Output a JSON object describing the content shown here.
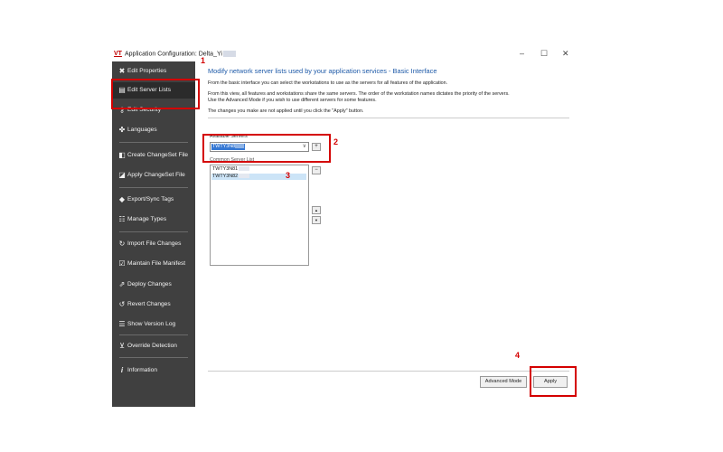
{
  "window": {
    "logo_text": "VT",
    "title": "Application Configuration: Delta_Yi",
    "minimize_glyph": "–",
    "maximize_glyph": "☐",
    "close_glyph": "✕"
  },
  "sidebar": {
    "items": [
      {
        "label": "Edit Properties",
        "icon": "wrench-icon",
        "glyph": "✖"
      },
      {
        "label": "Edit Server Lists",
        "icon": "server-icon",
        "glyph": "▤"
      },
      {
        "label": "Edit Security",
        "icon": "key-icon",
        "glyph": "⚷"
      },
      {
        "label": "Languages",
        "icon": "languages-icon",
        "glyph": "✤"
      },
      {
        "label": "Create ChangeSet File",
        "icon": "create-file-icon",
        "glyph": "◧"
      },
      {
        "label": "Apply ChangeSet File",
        "icon": "apply-file-icon",
        "glyph": "◪"
      },
      {
        "label": "Export/Sync Tags",
        "icon": "tag-icon",
        "glyph": "◆"
      },
      {
        "label": "Manage Types",
        "icon": "types-icon",
        "glyph": "☷"
      },
      {
        "label": "Import File Changes",
        "icon": "sync-icon",
        "glyph": "↻"
      },
      {
        "label": "Maintain File Manifest",
        "icon": "checkbox-icon",
        "glyph": "☑"
      },
      {
        "label": "Deploy Changes",
        "icon": "deploy-icon",
        "glyph": "⇗"
      },
      {
        "label": "Revert Changes",
        "icon": "revert-icon",
        "glyph": "↺"
      },
      {
        "label": "Show Version Log",
        "icon": "list-icon",
        "glyph": "☰"
      },
      {
        "label": "Override Detection",
        "icon": "override-icon",
        "glyph": "⊻"
      },
      {
        "label": "Information",
        "icon": "info-icon",
        "glyph": "i"
      }
    ]
  },
  "main": {
    "heading": "Modify network server lists used by your application services - Basic Interface",
    "line1": "From the basic interface you can select the workstations to use as the servers for all features of the application.",
    "line2a": "From this view, all features and workstations share the same servers. The order of the workstation names dictates the priority of the servers.",
    "line2b": "Use the Advanced Mode if you wish to use different servers for some features.",
    "line3": "The changes you make are not applied until you click the \"Apply\" button.",
    "available_label": "Available Servers",
    "available_value": "TWTY3N8",
    "common_label": "Common Server List",
    "servers": [
      "TWTY3N81",
      "TWTY3N82"
    ],
    "add_glyph": "+",
    "remove_glyph": "−",
    "up_glyph": "▲",
    "down_glyph": "▼",
    "combo_arrow": "∨",
    "advanced_button": "Advanced Mode",
    "apply_button": "Apply"
  },
  "annotations": {
    "n1": "1",
    "n2": "2",
    "n3": "3",
    "n4": "4",
    "color": "#d40000"
  }
}
